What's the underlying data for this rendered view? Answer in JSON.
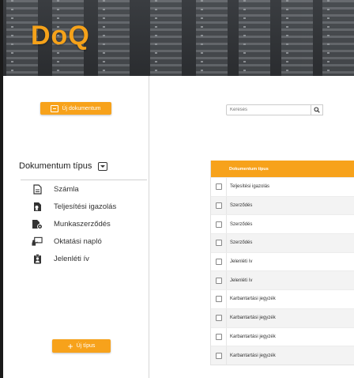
{
  "header": {
    "logo": "DoQ"
  },
  "sidebar": {
    "new_document_label": "Új dokumentum",
    "doctype_title": "Dokumentum típus",
    "types": [
      {
        "label": "Számla",
        "icon": "document-icon"
      },
      {
        "label": "Teljesítési igazolás",
        "icon": "file-certificate-icon"
      },
      {
        "label": "Munkaszerződés",
        "icon": "contract-settings-icon"
      },
      {
        "label": "Oktatási napló",
        "icon": "teacher-board-icon"
      },
      {
        "label": "Jelenléti ív",
        "icon": "clipboard-user-icon"
      }
    ],
    "new_type_label": "Új típus"
  },
  "search": {
    "placeholder": "Keresés"
  },
  "table": {
    "header": "Dokumentum típus",
    "rows": [
      "Teljesítési igazolás",
      "Szerződés",
      "Szerződés",
      "Szerződés",
      "Jelenléti ív",
      "Jelenléti ív",
      "Karbantartási jegyzék",
      "Karbantartási jegyzék",
      "Karbantartási jegyzék",
      "Karbantartási jegyzék"
    ]
  },
  "colors": {
    "accent": "#f7a21b",
    "logo": "#f5a21a"
  }
}
